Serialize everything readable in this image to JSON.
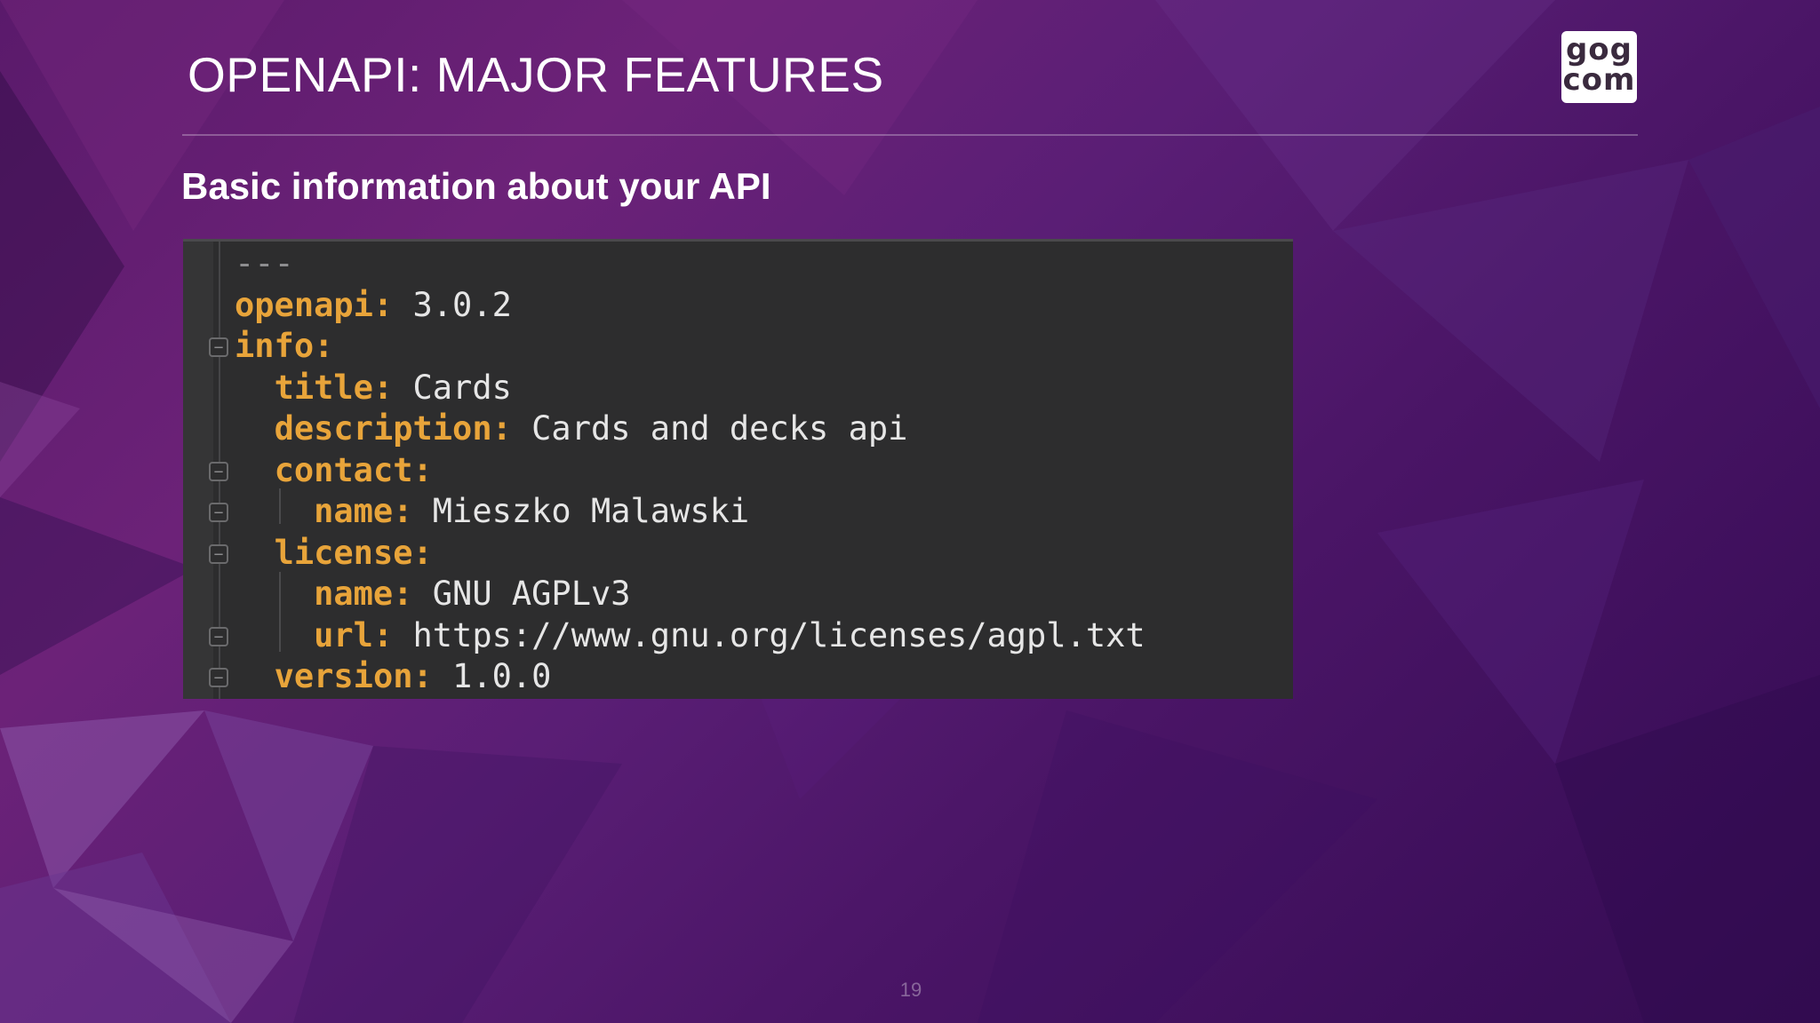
{
  "slide": {
    "title": "OPENAPI: MAJOR FEATURES",
    "subtitle": "Basic information about your API",
    "page_number": "19"
  },
  "logo": {
    "line1": "gog",
    "line2": "com"
  },
  "editor": {
    "accent_color": "#3b9fd6",
    "key_color": "#e8a43a",
    "value_color": "#e6e6e6",
    "lines": [
      {
        "indent": "",
        "key": "",
        "value": "---"
      },
      {
        "indent": "",
        "key": "openapi:",
        "value": " 3.0.2"
      },
      {
        "indent": "",
        "key": "info:",
        "value": ""
      },
      {
        "indent": "  ",
        "key": "title:",
        "value": " Cards"
      },
      {
        "indent": "  ",
        "key": "description:",
        "value": " Cards and decks api"
      },
      {
        "indent": "  ",
        "key": "contact:",
        "value": ""
      },
      {
        "indent": "    ",
        "key": "name:",
        "value": " Mieszko Malawski"
      },
      {
        "indent": "  ",
        "key": "license:",
        "value": ""
      },
      {
        "indent": "    ",
        "key": "name:",
        "value": " GNU AGPLv3"
      },
      {
        "indent": "    ",
        "key": "url:",
        "value": " https://www.gnu.org/licenses/agpl.txt"
      },
      {
        "indent": "  ",
        "key": "version:",
        "value": " 1.0.0"
      }
    ]
  }
}
